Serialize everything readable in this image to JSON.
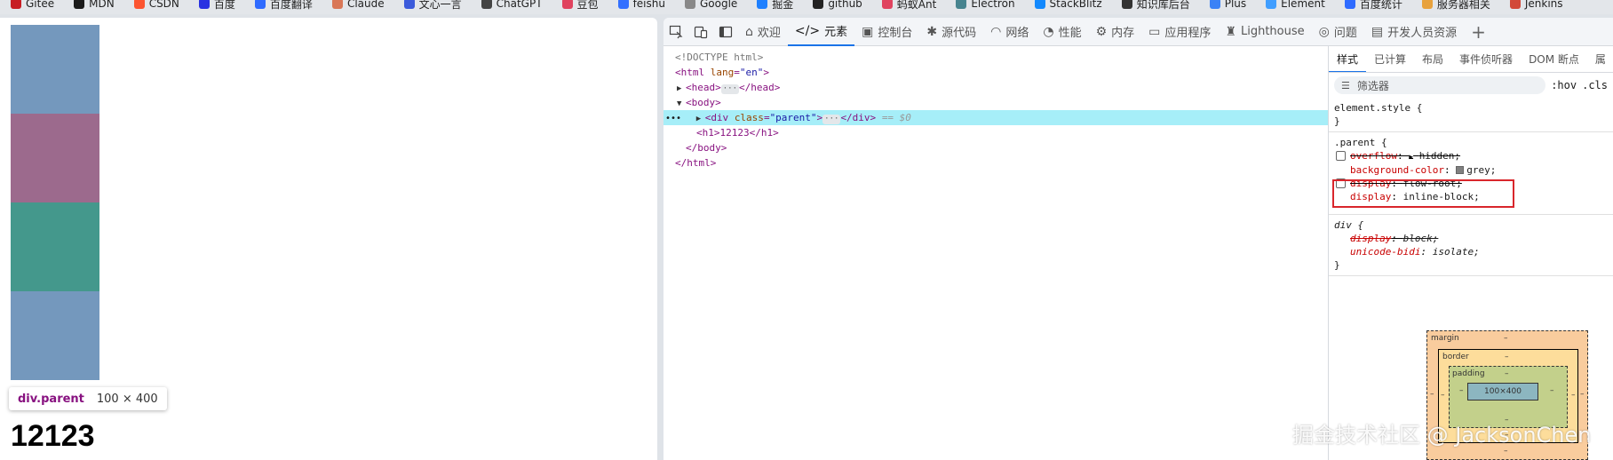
{
  "bookmarks": [
    {
      "label": "Gitee",
      "color": "#c71d23"
    },
    {
      "label": "MDN",
      "color": "#1b1b1b"
    },
    {
      "label": "CSDN",
      "color": "#fc5531"
    },
    {
      "label": "百度",
      "color": "#2932e1"
    },
    {
      "label": "百度翻译",
      "color": "#2f6bff"
    },
    {
      "label": "Claude",
      "color": "#d97757"
    },
    {
      "label": "文心一言",
      "color": "#3b5bdb"
    },
    {
      "label": "ChatGPT",
      "color": "#444444"
    },
    {
      "label": "豆包",
      "color": "#e0435f"
    },
    {
      "label": "feishu",
      "color": "#3370ff"
    },
    {
      "label": "Google",
      "color": "#888888"
    },
    {
      "label": "掘金",
      "color": "#1e80ff"
    },
    {
      "label": "github",
      "color": "#222222"
    },
    {
      "label": "蚂蚁Ant",
      "color": "#e0435f"
    },
    {
      "label": "Electron",
      "color": "#47848f"
    },
    {
      "label": "StackBlitz",
      "color": "#1389fd"
    },
    {
      "label": "知识库后台",
      "color": "#333333"
    },
    {
      "label": "Plus",
      "color": "#3b82f6"
    },
    {
      "label": "Element",
      "color": "#409eff"
    },
    {
      "label": "百度统计",
      "color": "#2f6bff"
    },
    {
      "label": "服务器相关",
      "color": "#e8a23d"
    },
    {
      "label": "Jenkins",
      "color": "#d24939"
    }
  ],
  "page": {
    "stripe_colors": [
      "#7498bd",
      "#9c6a8d",
      "#44988c",
      "#7498bd"
    ],
    "tooltip_name": "div.parent",
    "tooltip_size": "100 × 400",
    "heading": "12123"
  },
  "devtools": {
    "tabs": [
      {
        "label": "欢迎",
        "icon": "home-icon"
      },
      {
        "label": "元素",
        "icon": "code-icon"
      },
      {
        "label": "控制台",
        "icon": "console-icon"
      },
      {
        "label": "源代码",
        "icon": "bug-icon"
      },
      {
        "label": "网络",
        "icon": "wifi-icon"
      },
      {
        "label": "性能",
        "icon": "gauge-icon"
      },
      {
        "label": "内存",
        "icon": "gear-icon"
      },
      {
        "label": "应用程序",
        "icon": "window-icon"
      },
      {
        "label": "Lighthouse",
        "icon": "lighthouse-icon"
      },
      {
        "label": "问题",
        "icon": "bulb-icon"
      },
      {
        "label": "开发人员资源",
        "icon": "doc-icon"
      }
    ],
    "dom": {
      "doctype": "<!DOCTYPE html>",
      "html_tag": "html",
      "html_attr": "lang",
      "html_val": "\"en\"",
      "head_open": "<head>",
      "head_close": "</head>",
      "body_open": "<body>",
      "div_tag": "div",
      "div_attr": "class",
      "div_val": "\"parent\"",
      "div_close": "</div>",
      "sel_marker": "== $0",
      "h1_line": "<h1>12123</h1>",
      "body_close": "</body>",
      "html_close": "</html>",
      "ellipsis": "···"
    },
    "styles_tabs": [
      "样式",
      "已计算",
      "布局",
      "事件侦听器",
      "DOM 断点",
      "属"
    ],
    "filter_placeholder": "筛选器",
    "hov": ":hov",
    "cls": ".cls",
    "rules": {
      "element_style": "element.style {",
      "close": "}",
      "parent_sel": ".parent {",
      "div_sel": "div {",
      "decl1_prop": "overflow",
      "decl1_val": "hidden;",
      "decl2_prop": "background-color",
      "decl2_val": "grey;",
      "decl3_prop": "display",
      "decl3_val": "flow-root;",
      "decl4_prop": "display",
      "decl4_val": "inline-block;",
      "decl5_prop": "display",
      "decl5_val": "block;",
      "decl6_prop": "unicode-bidi",
      "decl6_val": "isolate;"
    },
    "boxmodel": {
      "margin": "margin",
      "border": "border",
      "padding": "padding",
      "content": "100×400",
      "dash": "–"
    }
  },
  "watermark": "掘金技术社区 @ JacksonChen"
}
